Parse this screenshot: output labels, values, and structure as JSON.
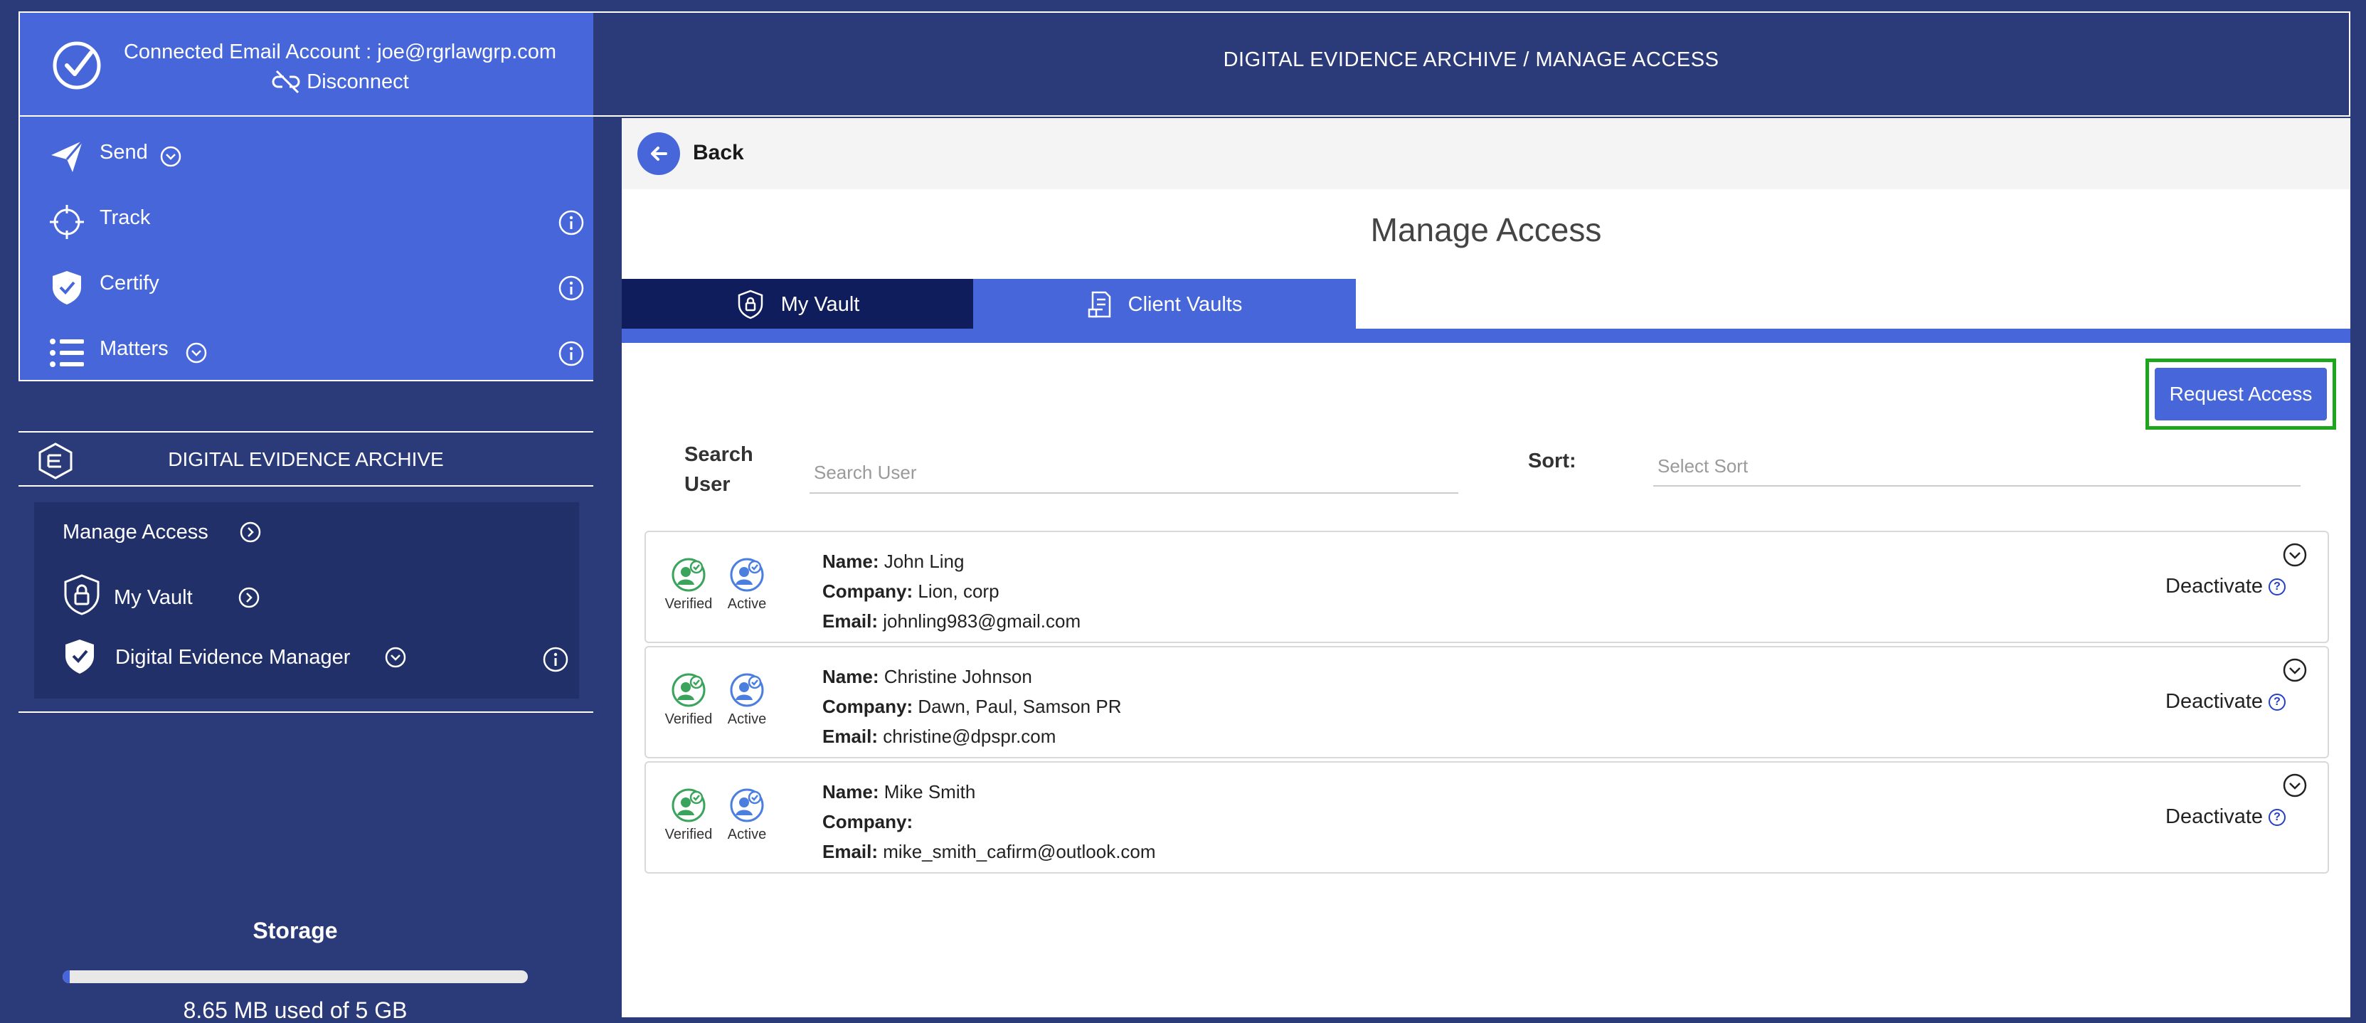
{
  "colors": {
    "sidebar_bg": "#2b3a78",
    "accent_blue": "#4666d9",
    "tab_dark": "#101d5c",
    "verified_green": "#3aa35c",
    "active_blue": "#4a7fe0",
    "highlight_green": "#1ea51e"
  },
  "account": {
    "connected_text": "Connected Email Account : joe@rgrlawgrp.com",
    "disconnect_label": "Disconnect"
  },
  "nav": {
    "items": [
      {
        "label": "Send",
        "icon": "send-icon"
      },
      {
        "label": "Track",
        "icon": "crosshair-icon"
      },
      {
        "label": "Certify",
        "icon": "shield-check-icon"
      },
      {
        "label": "Matters",
        "icon": "list-icon"
      }
    ]
  },
  "dea": {
    "title": "DIGITAL EVIDENCE ARCHIVE",
    "items": [
      {
        "label": "Manage Access"
      },
      {
        "label": "My Vault"
      },
      {
        "label": "Digital Evidence Manager"
      }
    ]
  },
  "storage": {
    "title": "Storage",
    "used_fraction": 0.0017,
    "text": "8.65 MB  used of 5 GB"
  },
  "header": {
    "breadcrumb": "DIGITAL EVIDENCE ARCHIVE / MANAGE ACCESS"
  },
  "main": {
    "back_label": "Back",
    "title": "Manage Access",
    "tabs": [
      {
        "label": "My Vault",
        "active": false
      },
      {
        "label": "Client Vaults",
        "active": true
      }
    ],
    "request_access_label": "Request Access",
    "search_label_line1": "Search",
    "search_label_line2": "User",
    "search_placeholder": "Search User",
    "sort_label": "Sort:",
    "sort_placeholder": "Select Sort"
  },
  "users": {
    "verified_label": "Verified",
    "active_label": "Active",
    "name_key": "Name:",
    "company_key": "Company:",
    "email_key": "Email:",
    "deactivate_label": "Deactivate",
    "help_symbol": "?",
    "rows": [
      {
        "name": "John Ling",
        "company": "Lion, corp",
        "email": "johnling983@gmail.com"
      },
      {
        "name": "Christine Johnson",
        "company": "Dawn, Paul, Samson PR",
        "email": "christine@dpspr.com"
      },
      {
        "name": "Mike Smith",
        "company": "",
        "email": "mike_smith_cafirm@outlook.com"
      }
    ]
  }
}
